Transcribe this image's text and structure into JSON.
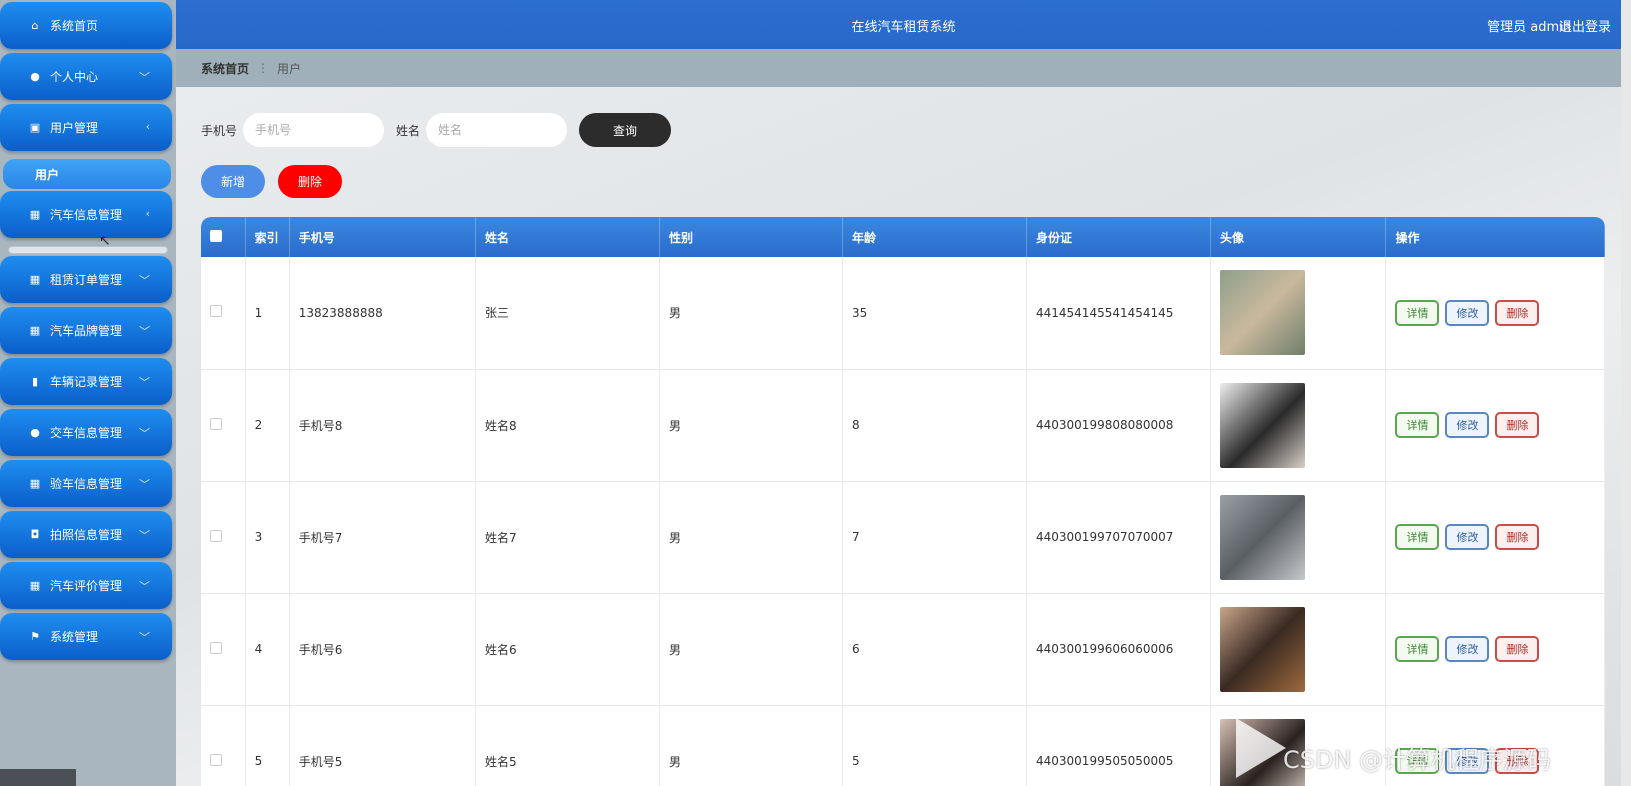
{
  "header": {
    "title": "在线汽车租赁系统",
    "user": "管理员 admin",
    "logout": "退出登录"
  },
  "sidebar": {
    "items": [
      {
        "label": "系统首页",
        "icon": "home-icon"
      },
      {
        "label": "个人中心",
        "icon": "user-icon"
      },
      {
        "label": "用户管理",
        "icon": "chart-icon"
      },
      {
        "label": "汽车信息管理",
        "icon": "grid-icon"
      },
      {
        "label": "租赁订单管理",
        "icon": "grid-icon"
      },
      {
        "label": "汽车品牌管理",
        "icon": "grid-icon"
      },
      {
        "label": "车辆记录管理",
        "icon": "bar-chart-icon"
      },
      {
        "label": "交车信息管理",
        "icon": "user-icon"
      },
      {
        "label": "验车信息管理",
        "icon": "grid-icon"
      },
      {
        "label": "拍照信息管理",
        "icon": "camera-icon"
      },
      {
        "label": "汽车评价管理",
        "icon": "grid-icon"
      },
      {
        "label": "系统管理",
        "icon": "flag-icon"
      }
    ],
    "active_sub": "用户"
  },
  "breadcrumb": {
    "home": "系统首页",
    "current": "用户"
  },
  "search": {
    "phone_label": "手机号",
    "phone_placeholder": "手机号",
    "name_label": "姓名",
    "name_placeholder": "姓名",
    "query": "查询"
  },
  "actions": {
    "add": "新增",
    "delete": "删除"
  },
  "table": {
    "headers": [
      "索引",
      "手机号",
      "姓名",
      "性别",
      "年龄",
      "身份证",
      "头像",
      "操作"
    ],
    "rows": [
      {
        "index": "1",
        "phone": "13823888888",
        "name": "张三",
        "gender": "男",
        "age": "35",
        "id": "441454145541454145"
      },
      {
        "index": "2",
        "phone": "手机号8",
        "name": "姓名8",
        "gender": "男",
        "age": "8",
        "id": "440300199808080008"
      },
      {
        "index": "3",
        "phone": "手机号7",
        "name": "姓名7",
        "gender": "男",
        "age": "7",
        "id": "440300199707070007"
      },
      {
        "index": "4",
        "phone": "手机号6",
        "name": "姓名6",
        "gender": "男",
        "age": "6",
        "id": "440300199606060006"
      },
      {
        "index": "5",
        "phone": "手机号5",
        "name": "姓名5",
        "gender": "男",
        "age": "5",
        "id": "440300199505050005"
      }
    ],
    "ops": {
      "detail": "详情",
      "edit": "修改",
      "remove": "删除"
    }
  },
  "watermark": "CSDN @计算机程序源码"
}
